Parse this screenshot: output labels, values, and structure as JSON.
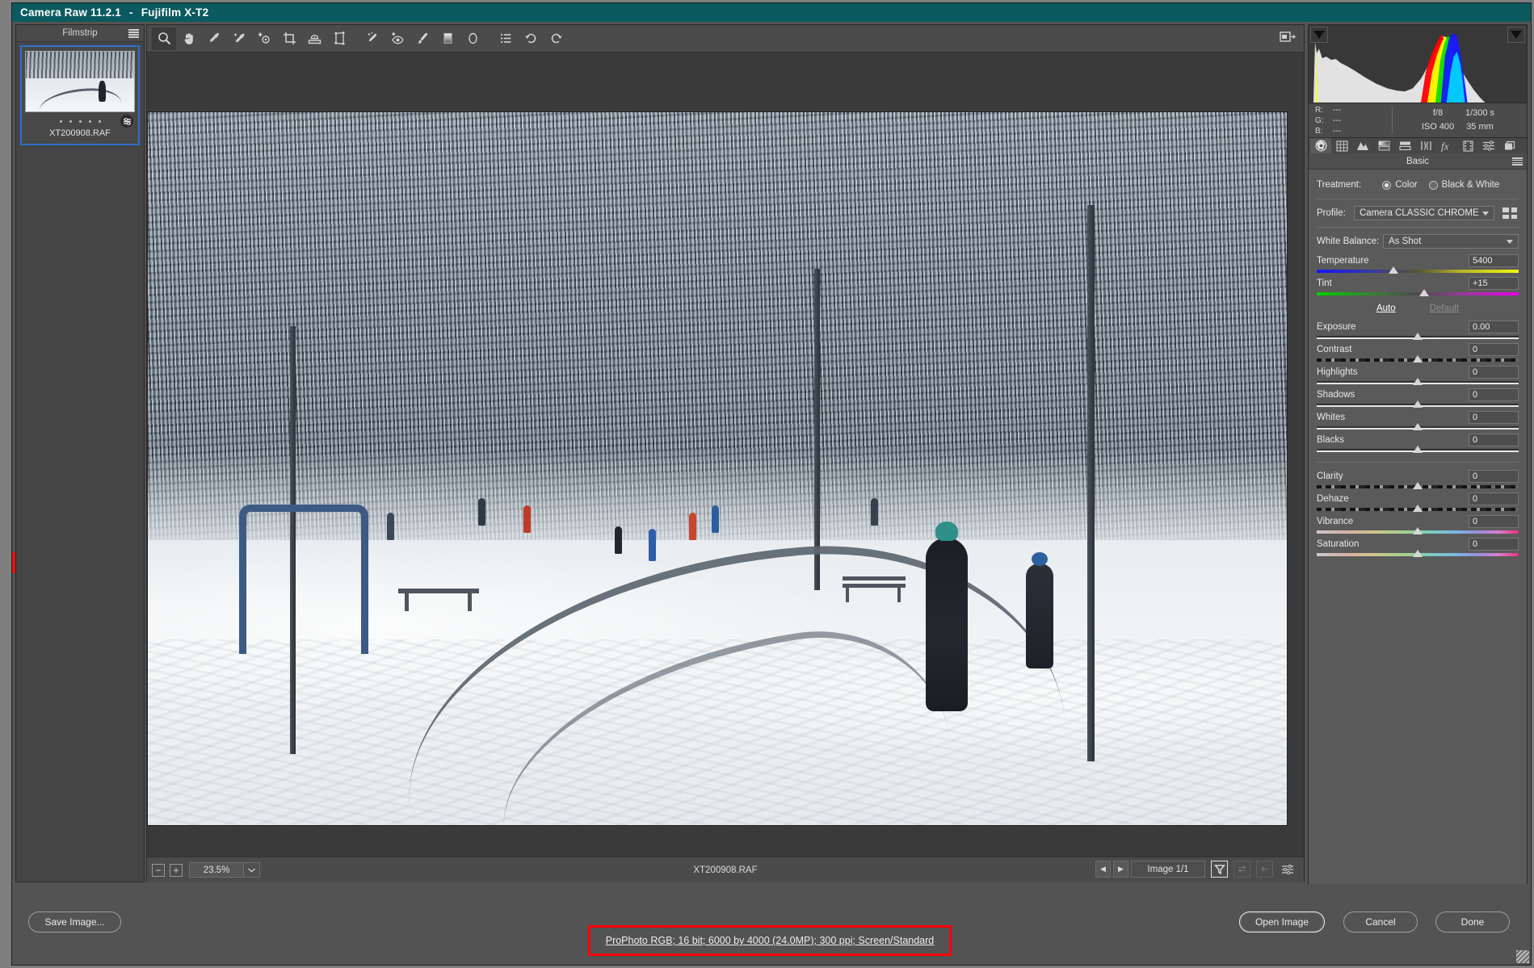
{
  "window": {
    "title": "Camera Raw 11.2.1",
    "separator": "-",
    "camera": "Fujifilm X-T2"
  },
  "filmstrip": {
    "title": "Filmstrip",
    "menu_icon": "hamburger-menu-icon",
    "thumbnails": [
      {
        "filename": "XT200908.RAF",
        "selected": true,
        "rating_dots": 5,
        "badge": "adjustment-badge-icon"
      }
    ]
  },
  "toolbar": {
    "tools": [
      {
        "name": "zoom-tool",
        "icon": "magnifier-icon",
        "active": true
      },
      {
        "name": "hand-tool",
        "icon": "hand-icon",
        "active": false
      },
      {
        "name": "white-balance-tool",
        "icon": "eyedropper-icon",
        "active": false
      },
      {
        "name": "color-sampler-tool",
        "icon": "color-sampler-icon",
        "active": false
      },
      {
        "name": "targeted-adjustment-tool",
        "icon": "targeted-adjustment-icon",
        "active": false
      },
      {
        "name": "crop-tool",
        "icon": "crop-icon",
        "active": false
      },
      {
        "name": "straighten-tool",
        "icon": "straighten-icon",
        "active": false
      },
      {
        "name": "transform-tool",
        "icon": "transform-icon",
        "active": false
      },
      {
        "name": "spot-removal-tool",
        "icon": "spot-removal-icon",
        "active": false
      },
      {
        "name": "red-eye-tool",
        "icon": "red-eye-icon",
        "active": false
      },
      {
        "name": "adjustment-brush-tool",
        "icon": "brush-icon",
        "active": false
      },
      {
        "name": "graduated-filter-tool",
        "icon": "graduated-filter-icon",
        "active": false
      },
      {
        "name": "radial-filter-tool",
        "icon": "radial-filter-icon",
        "active": false
      },
      {
        "name": "presets-tool",
        "icon": "list-icon",
        "active": false
      },
      {
        "name": "rotate-ccw-tool",
        "icon": "rotate-counterclockwise-icon",
        "active": false
      },
      {
        "name": "rotate-cw-tool",
        "icon": "rotate-clockwise-icon",
        "active": false
      }
    ],
    "fullscreen_icon": "toggle-fullscreen-icon"
  },
  "canvas": {
    "filename": "XT200908.RAF",
    "zoom_level": "23.5%",
    "zoom_out_label": "−",
    "zoom_in_label": "+",
    "image_count": "Image 1/1",
    "prev_label": "◀",
    "next_label": "▶",
    "filter_icon": "filter-funnel-icon",
    "sync_icon": "sync-settings-icon",
    "arrow_icon": "left-arrow-icon",
    "sliders_icon": "settings-sliders-icon"
  },
  "histogram": {
    "shadow_clip_icon": "shadow-clipping-triangle-icon",
    "highlight_clip_icon": "highlight-clipping-triangle-icon"
  },
  "readout": {
    "r_label": "R:",
    "g_label": "G:",
    "b_label": "B:",
    "r_value": "---",
    "g_value": "---",
    "b_value": "---",
    "aperture": "f/8",
    "shutter": "1/300 s",
    "iso": "ISO 400",
    "focal_length": "35 mm"
  },
  "panel": {
    "tabs": [
      {
        "name": "tab-basic",
        "icon": "aperture-icon",
        "active": true
      },
      {
        "name": "tab-tone-curve",
        "icon": "tone-curve-icon",
        "active": false
      },
      {
        "name": "tab-detail",
        "icon": "detail-triangles-icon",
        "active": false
      },
      {
        "name": "tab-hsl-grayscale",
        "icon": "hsl-gradient-icon",
        "active": false
      },
      {
        "name": "tab-split-toning",
        "icon": "split-toning-icon",
        "active": false
      },
      {
        "name": "tab-lens-corrections",
        "icon": "lens-corrections-icon",
        "active": false
      },
      {
        "name": "tab-effects",
        "icon": "fx-icon",
        "active": false
      },
      {
        "name": "tab-calibration",
        "icon": "calibration-filmstrip-icon",
        "active": false
      },
      {
        "name": "tab-presets",
        "icon": "presets-sliders-icon",
        "active": false
      },
      {
        "name": "tab-snapshots",
        "icon": "snapshots-layers-icon",
        "active": false
      }
    ],
    "title": "Basic",
    "menu_icon": "panel-menu-icon",
    "treatment": {
      "label": "Treatment:",
      "options": [
        {
          "label": "Color",
          "selected": true
        },
        {
          "label": "Black & White",
          "selected": false
        }
      ]
    },
    "profile": {
      "label": "Profile:",
      "value": "Camera CLASSIC CHROME",
      "browser_icon": "profile-browser-grid-icon"
    },
    "white_balance": {
      "label": "White Balance:",
      "value": "As Shot"
    },
    "auto_label": "Auto",
    "default_label": "Default",
    "sliders": [
      {
        "name": "temperature",
        "label": "Temperature",
        "value": "5400",
        "pos": 38,
        "track": "temp"
      },
      {
        "name": "tint",
        "label": "Tint",
        "value": "+15",
        "pos": 53,
        "track": "tint"
      },
      {
        "name": "exposure",
        "label": "Exposure",
        "value": "0.00",
        "pos": 50,
        "track": "plain"
      },
      {
        "name": "contrast",
        "label": "Contrast",
        "value": "0",
        "pos": 50,
        "track": "contrasty"
      },
      {
        "name": "highlights",
        "label": "Highlights",
        "value": "0",
        "pos": 50,
        "track": "plain"
      },
      {
        "name": "shadows",
        "label": "Shadows",
        "value": "0",
        "pos": 50,
        "track": "plain"
      },
      {
        "name": "whites",
        "label": "Whites",
        "value": "0",
        "pos": 50,
        "track": "plain"
      },
      {
        "name": "blacks",
        "label": "Blacks",
        "value": "0",
        "pos": 50,
        "track": "plain"
      },
      {
        "name": "clarity",
        "label": "Clarity",
        "value": "0",
        "pos": 50,
        "track": "contrasty"
      },
      {
        "name": "dehaze",
        "label": "Dehaze",
        "value": "0",
        "pos": 50,
        "track": "contrasty"
      },
      {
        "name": "vibrance",
        "label": "Vibrance",
        "value": "0",
        "pos": 50,
        "track": "rainbow"
      },
      {
        "name": "saturation",
        "label": "Saturation",
        "value": "0",
        "pos": 50,
        "track": "rainbow"
      }
    ]
  },
  "bottom": {
    "save_image_label": "Save Image...",
    "workflow_options": "ProPhoto RGB; 16 bit; 6000 by 4000 (24.0MP); 300 ppi; Screen/Standard",
    "open_image_label": "Open Image",
    "cancel_label": "Cancel",
    "done_label": "Done"
  },
  "colors": {
    "title_bar": "#0b5a5f",
    "panel_bg": "#5a5a5a",
    "selection_blue": "#2f6fd0",
    "highlight_red": "#ff0008"
  }
}
